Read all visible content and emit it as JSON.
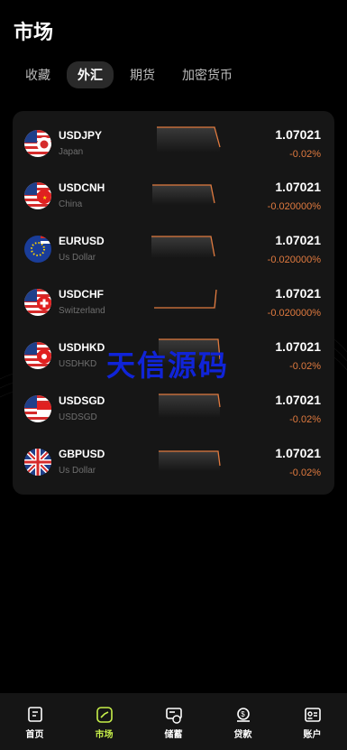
{
  "page": {
    "title": "市场"
  },
  "tabs": [
    {
      "label": "收藏",
      "active": false
    },
    {
      "label": "外汇",
      "active": true
    },
    {
      "label": "期货",
      "active": false
    },
    {
      "label": "加密货币",
      "active": false
    }
  ],
  "rows": [
    {
      "symbol": "USDJPY",
      "sub": "Japan",
      "price": "1.07021",
      "change": "-0.02%",
      "flag": "us-jp"
    },
    {
      "symbol": "USDCNH",
      "sub": "China",
      "price": "1.07021",
      "change": "-0.020000%",
      "flag": "us-cn"
    },
    {
      "symbol": "EURUSD",
      "sub": "Us Dollar",
      "price": "1.07021",
      "change": "-0.020000%",
      "flag": "eu-us"
    },
    {
      "symbol": "USDCHF",
      "sub": "Switzerland",
      "price": "1.07021",
      "change": "-0.020000%",
      "flag": "us-ch"
    },
    {
      "symbol": "USDHKD",
      "sub": "USDHKD",
      "price": "1.07021",
      "change": "-0.02%",
      "flag": "us-hk"
    },
    {
      "symbol": "USDSGD",
      "sub": "USDSGD",
      "price": "1.07021",
      "change": "-0.02%",
      "flag": "us-sg"
    },
    {
      "symbol": "GBPUSD",
      "sub": "Us Dollar",
      "price": "1.07021",
      "change": "-0.02%",
      "flag": "gb-us"
    }
  ],
  "watermark": "天信源码",
  "nav": [
    {
      "label": "首页",
      "icon": "home-icon",
      "active": false
    },
    {
      "label": "市场",
      "icon": "market-icon",
      "active": true
    },
    {
      "label": "储蓄",
      "icon": "savings-icon",
      "active": false
    },
    {
      "label": "贷款",
      "icon": "loan-icon",
      "active": false
    },
    {
      "label": "账户",
      "icon": "account-icon",
      "active": false
    }
  ],
  "colors": {
    "accent": "#c7f04a",
    "change": "#e07a3f",
    "spark": "#e07a3f"
  }
}
